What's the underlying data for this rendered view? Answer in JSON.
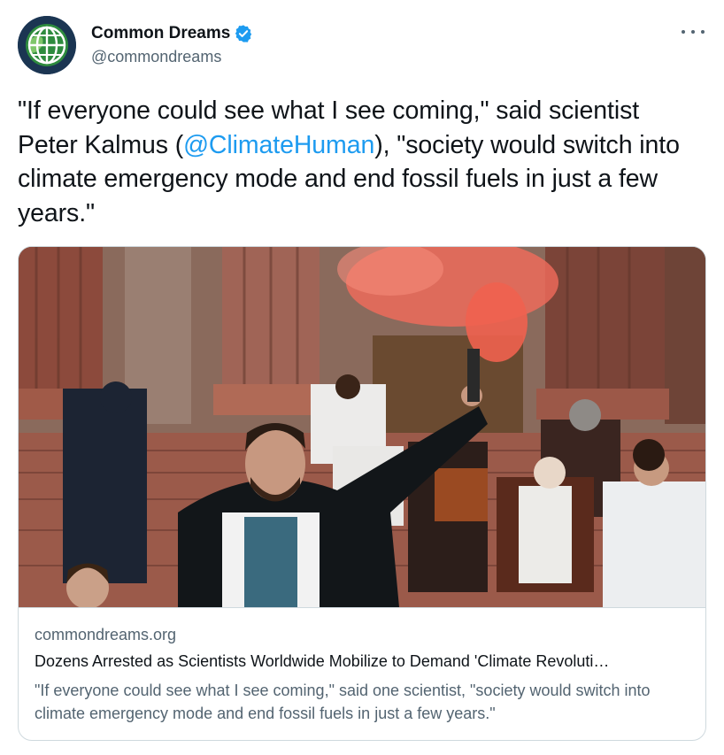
{
  "author": {
    "display_name": "Common Dreams",
    "handle": "@commondreams",
    "verified": true,
    "avatar_icon": "globe-logo-icon"
  },
  "tweet": {
    "text_part1": "\"If everyone could see what I see coming,\" said scientist Peter Kalmus (",
    "mention": "@ClimateHuman",
    "text_part2": "), \"society would switch into climate emergency mode and end fossil fuels in just a few years.\""
  },
  "card": {
    "domain": "commondreams.org",
    "title": "Dozens Arrested as Scientists Worldwide Mobilize to Demand 'Climate Revoluti…",
    "description": "\"If everyone could see what I see coming,\" said one scientist, \"society would switch into climate emergency mode and end fossil fuels in just a few years.\"",
    "image_subject": "protest-photo"
  },
  "colors": {
    "link": "#1d9bf0",
    "secondary_text": "#536471",
    "verified_badge": "#1d9bf0",
    "smoke": "#f26b5b"
  }
}
